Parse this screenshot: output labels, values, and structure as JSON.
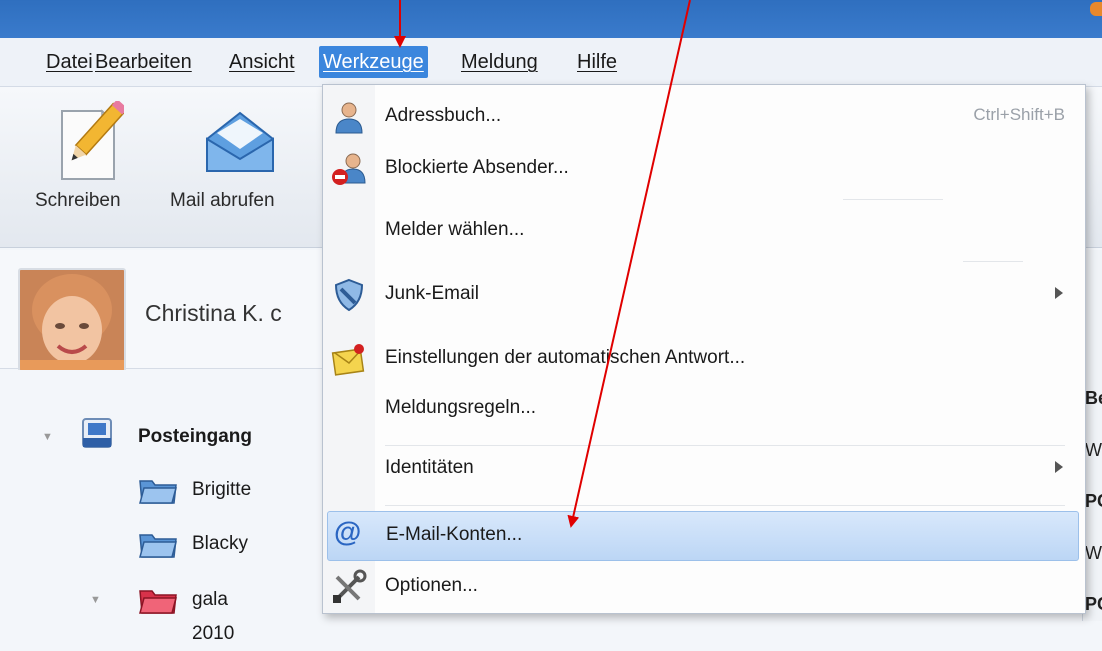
{
  "menubar": {
    "items": [
      {
        "label": "Datei"
      },
      {
        "label": "Bearbeiten"
      },
      {
        "label": "Ansicht"
      },
      {
        "label": "Werkzeuge"
      },
      {
        "label": "Meldung"
      },
      {
        "label": "Hilfe"
      }
    ],
    "active_item": "Werkzeuge"
  },
  "toolbar": {
    "compose_label": "Schreiben",
    "get_mail_label": "Mail abrufen"
  },
  "profile": {
    "name": "Christina K. c"
  },
  "folders": [
    {
      "label": "Posteingang",
      "icon": "inbox-icon",
      "bold": true
    },
    {
      "label": "Brigitte",
      "icon": "folder-icon"
    },
    {
      "label": "Blacky",
      "icon": "folder-icon"
    },
    {
      "label": "gala 2010",
      "icon": "red-folder-icon"
    }
  ],
  "right_column_fragments": [
    "Be",
    "W",
    "PC",
    "W",
    "PC"
  ],
  "tools_menu": {
    "items": [
      {
        "label": "Adressbuch...",
        "icon": "address-book-icon",
        "shortcut": "Ctrl+Shift+B"
      },
      {
        "label": "Blockierte Absender...",
        "icon": "blocked-senders-icon"
      },
      {
        "label": "Melder wählen...",
        "icon": ""
      },
      {
        "label": "Junk-Email",
        "icon": "junk-email-shield-icon",
        "submenu": true
      },
      {
        "label": "Einstellungen der automatischen Antwort...",
        "icon": "auto-reply-envelope-icon"
      },
      {
        "label": "Meldungsregeln...",
        "icon": ""
      },
      {
        "label": "Identitäten",
        "icon": "",
        "submenu": true
      },
      {
        "label": "E-Mail-Konten...",
        "icon": "at-sign-icon",
        "highlighted": true
      },
      {
        "label": "Optionen...",
        "icon": "tools-options-icon"
      }
    ]
  },
  "colors": {
    "titlebar": "#2f6fbf",
    "menu_active": "#3b86dd",
    "highlight": "#bcd6f5",
    "annotation_arrow": "#e00000"
  }
}
